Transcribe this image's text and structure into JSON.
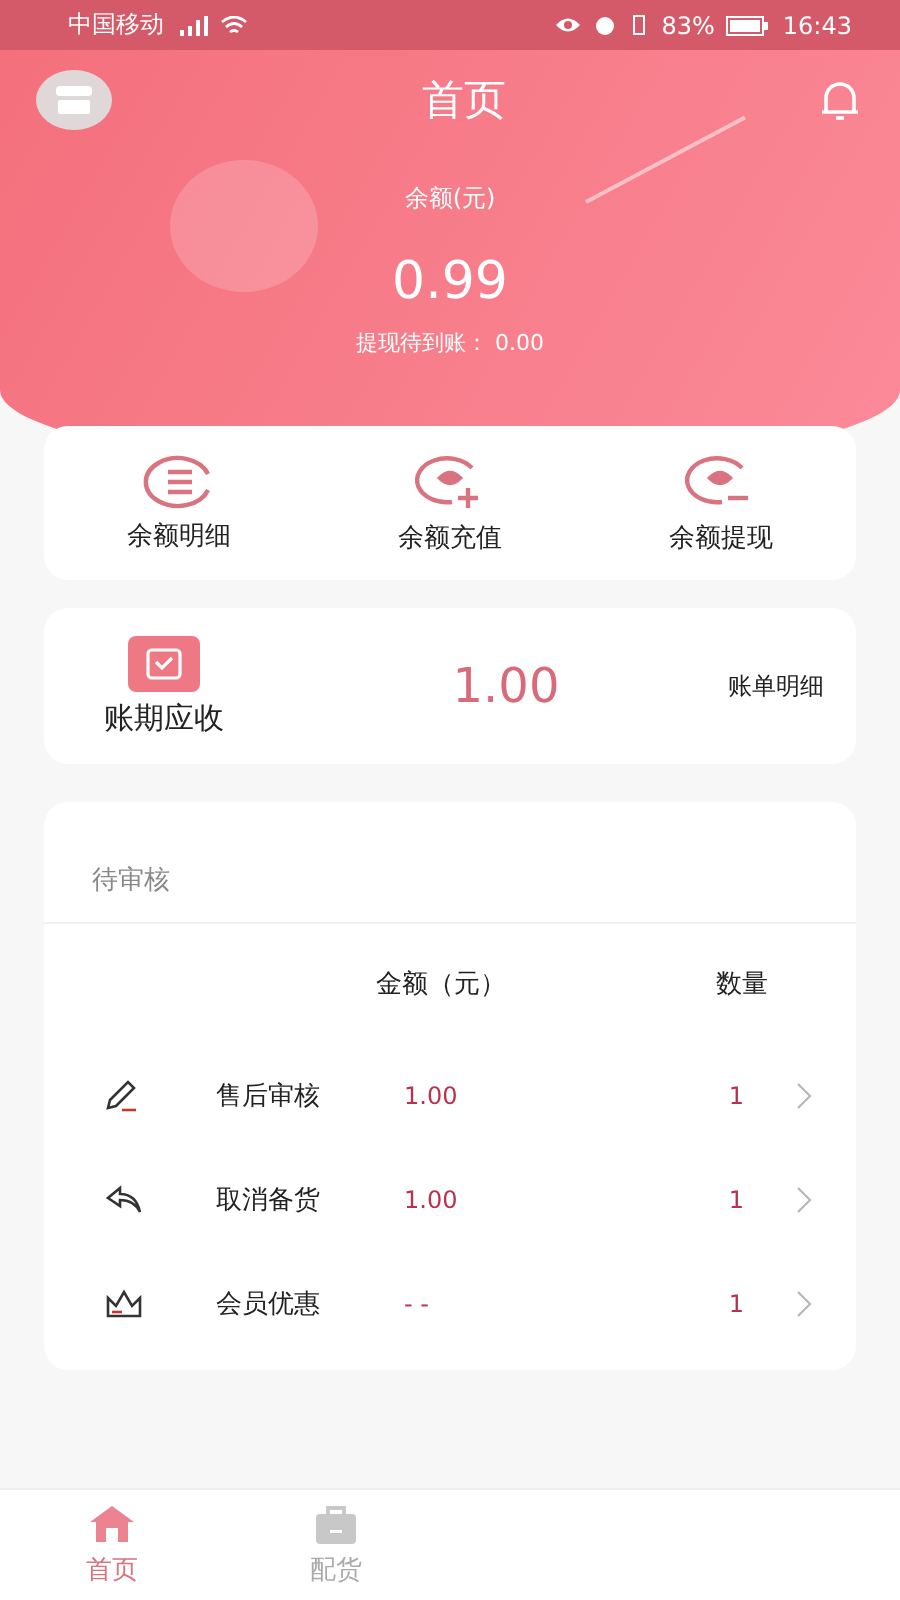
{
  "status_bar": {
    "carrier": "中国移动",
    "battery": "83%",
    "time": "16:43"
  },
  "header": {
    "title": "首页",
    "balance_label": "余额(元)",
    "balance": "0.99",
    "pending": "提现待到账：  0.00"
  },
  "actions": [
    {
      "kind": "list",
      "label": "余额明细"
    },
    {
      "kind": "add",
      "label": "余额充值"
    },
    {
      "kind": "minus",
      "label": "余额提现"
    }
  ],
  "billing": {
    "label": "账期应收",
    "amount": "1.00",
    "link": "账单明细"
  },
  "review": {
    "title": "待审核",
    "columns": [
      "金额（元）",
      "数量"
    ],
    "rows": [
      {
        "kind": "pencil",
        "name": "售后审核",
        "amount": "1.00",
        "count": "1"
      },
      {
        "kind": "reply",
        "name": "取消备货",
        "amount": "1.00",
        "count": "1"
      },
      {
        "kind": "crown",
        "name": "会员优惠",
        "amount": "- -",
        "count": "1"
      }
    ]
  },
  "tabs": [
    {
      "kind": "home",
      "label": "首页",
      "selected": true
    },
    {
      "kind": "bag",
      "label": "配货",
      "selected": false
    }
  ]
}
